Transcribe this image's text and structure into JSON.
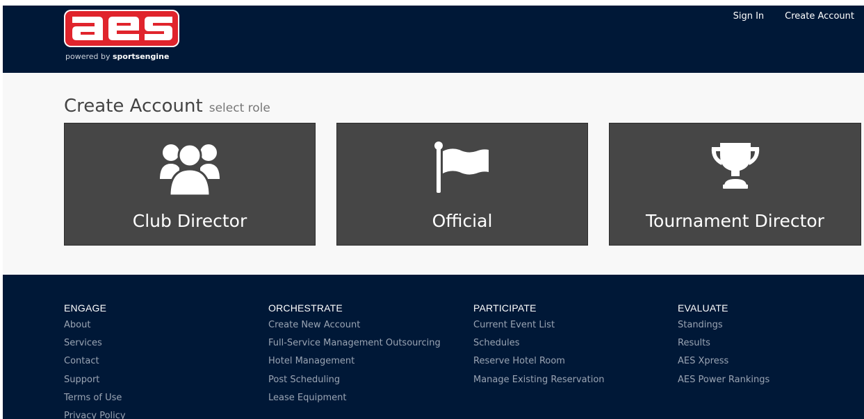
{
  "header": {
    "logo_text": "aes",
    "logo_tagline_prefix": "powered by ",
    "logo_tagline_brand": "sportsengine",
    "nav": {
      "sign_in": "Sign In",
      "create_account": "Create Account"
    }
  },
  "page": {
    "title": "Create Account",
    "subtitle": "select role"
  },
  "roles": [
    {
      "label": "Club Director",
      "icon": "users-group-icon"
    },
    {
      "label": "Official",
      "icon": "flag-icon"
    },
    {
      "label": "Tournament Director",
      "icon": "trophy-icon"
    }
  ],
  "footer": {
    "columns": [
      {
        "heading": "ENGAGE",
        "links": [
          "About",
          "Services",
          "Contact",
          "Support",
          "Terms of Use",
          "Privacy Policy"
        ]
      },
      {
        "heading": "ORCHESTRATE",
        "links": [
          "Create New Account",
          "Full-Service Management Outsourcing",
          "Hotel Management",
          "Post Scheduling",
          "Lease Equipment"
        ]
      },
      {
        "heading": "PARTICIPATE",
        "links": [
          "Current Event List",
          "Schedules",
          "Reserve Hotel Room",
          "Manage Existing Reservation"
        ]
      },
      {
        "heading": "EVALUATE",
        "links": [
          "Standings",
          "Results",
          "AES Xpress",
          "AES Power Rankings"
        ]
      }
    ]
  },
  "colors": {
    "navy": "#001837",
    "brand_red": "#e0242c",
    "card_gray": "#464646",
    "footer_link": "#9aa4b3"
  }
}
